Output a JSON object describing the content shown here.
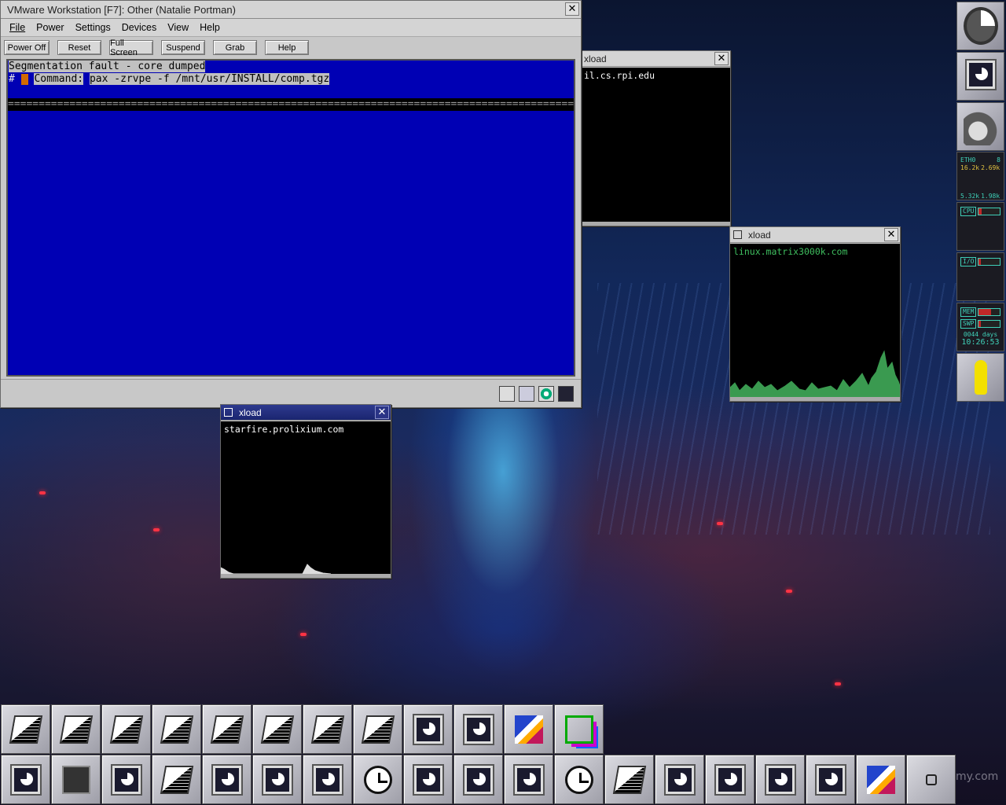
{
  "vmware": {
    "title": "VMware Workstation [F7]: Other (Natalie Portman)",
    "menu": [
      "File",
      "Power",
      "Settings",
      "Devices",
      "View",
      "Help"
    ],
    "toolbar": [
      "Power Off",
      "Reset",
      "Full Screen",
      "Suspend",
      "Grab",
      "Help"
    ],
    "console": {
      "line1": "Segmentation fault - core dumped",
      "prompt": "#",
      "command_label": "Command:",
      "command_value": "pax -zrvpe -f /mnt/usr/INSTALL/comp.tgz",
      "divider": "================================================================================================"
    }
  },
  "xload_windows": [
    {
      "title": "xload",
      "host": "il.cs.rpi.edu",
      "color": "#ffffff"
    },
    {
      "title": "xload",
      "host": "linux.matrix3000k.com",
      "color": "#3fbf5f"
    },
    {
      "title": "xload",
      "host": "starfire.prolixium.com",
      "color": "#ffffff"
    }
  ],
  "dock": {
    "net_label": "ETH0",
    "net_num": "8",
    "net_in": "16.2k",
    "net_out": "2.69k",
    "net_in2": "5.32k",
    "net_out2": "1.98k",
    "cpu_label": "CPU",
    "io_label": "I/O",
    "mem_label": "MEM",
    "swp_label": "SWP",
    "uptime": "0044 days",
    "clock": "10:26:53"
  },
  "watermark": "my.com"
}
